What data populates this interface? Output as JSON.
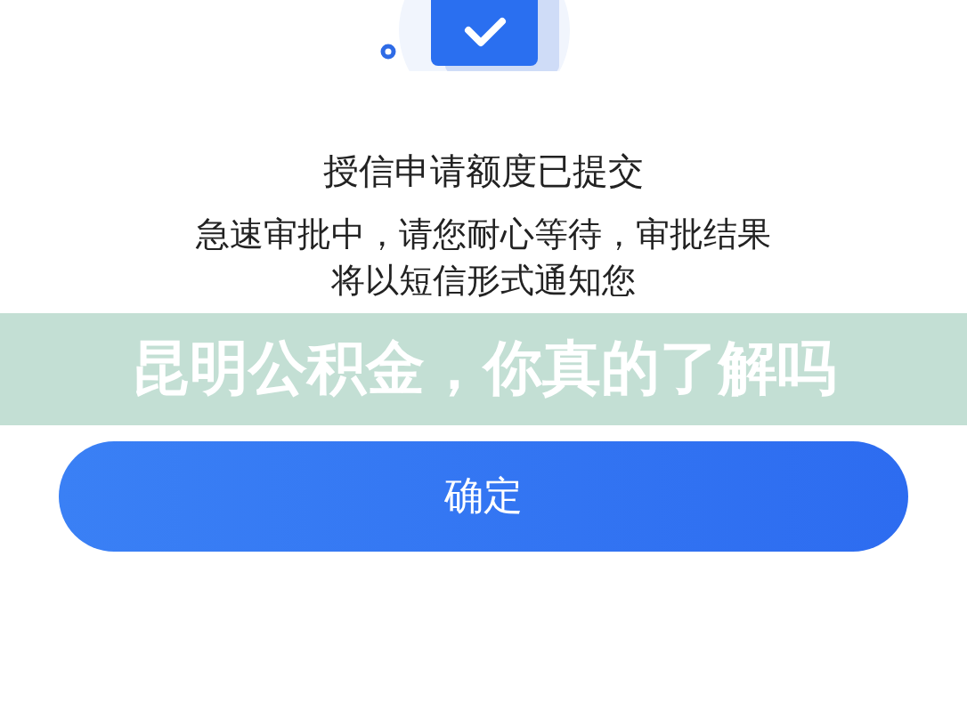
{
  "title": "授信申请额度已提交",
  "message_lines": [
    "急速审批中，请您耐心等待，审批结果",
    "将以短信形式通知您"
  ],
  "banner": {
    "text": "昆明公积金，你真的了解吗"
  },
  "buttons": [
    {
      "label": "确定"
    }
  ]
}
